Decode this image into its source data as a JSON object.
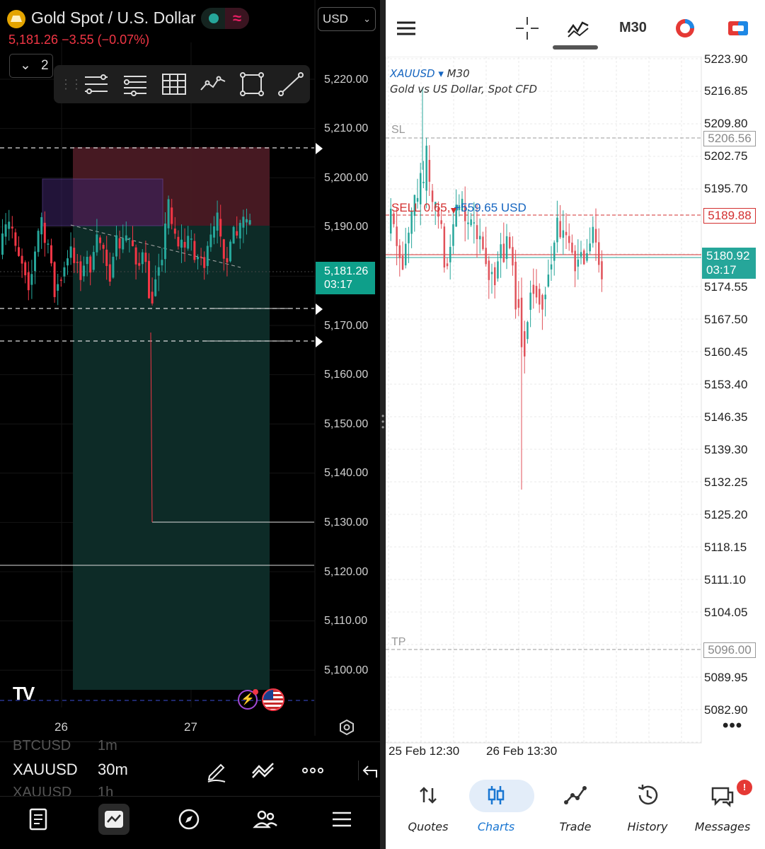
{
  "left": {
    "header": {
      "title": "Gold Spot / U.S. Dollar",
      "price_line": "5,181.26  −3.55 (−0.07%)",
      "currency": "USD",
      "layers_count": "2"
    },
    "toolbar": {
      "icons": [
        "fib-retracement-icon",
        "fib-extension-icon",
        "grid-icon",
        "trend-path-icon",
        "rectangle-icon",
        "line-icon"
      ]
    },
    "price_axis": [
      "5,220.00",
      "5,210.00",
      "5,200.00",
      "5,190.00",
      "5,170.00",
      "5,160.00",
      "5,150.00",
      "5,140.00",
      "5,130.00",
      "5,120.00",
      "5,110.00",
      "5,100.00"
    ],
    "current_price": "5,181.26",
    "countdown": "03:17",
    "dates": [
      "26",
      "27"
    ],
    "bottom": {
      "ghost_symbol_top": "BTCUSD",
      "ghost_interval_top": "1m",
      "symbol": "XAUUSD",
      "interval": "30m",
      "ghost_symbol_bottom": "XAUUSD",
      "ghost_interval_bottom": "1h"
    },
    "nav": [
      "watchlist-icon",
      "chart-icon",
      "explore-icon",
      "community-icon",
      "menu-icon"
    ]
  },
  "right": {
    "toolbar": {
      "timeframe": "M30"
    },
    "symbol": "XAUUSD",
    "symbol_timeframe": "M30",
    "description": "Gold vs US Dollar, Spot CFD",
    "price_axis": [
      "5223.90",
      "5216.85",
      "5209.80",
      "5202.75",
      "5195.70",
      "5174.55",
      "5167.50",
      "5160.45",
      "5153.40",
      "5146.35",
      "5139.30",
      "5132.25",
      "5125.20",
      "5118.15",
      "5111.10",
      "5104.05",
      "5089.95",
      "5082.90"
    ],
    "sl_label": "SL",
    "sl_price": "5206.56",
    "tp_label": "TP",
    "tp_price": "5096.00",
    "sell_text": "SELL 0.65,",
    "sell_profit": "+559.65 USD",
    "sell_price": "5189.88",
    "current_price": "5180.92",
    "countdown": "03:17",
    "dates": [
      "25 Feb 12:30",
      "26 Feb 13:30"
    ],
    "nav": [
      {
        "label": "Quotes",
        "icon": "quotes-icon"
      },
      {
        "label": "Charts",
        "icon": "charts-icon",
        "active": true
      },
      {
        "label": "Trade",
        "icon": "trade-icon"
      },
      {
        "label": "History",
        "icon": "history-icon"
      },
      {
        "label": "Messages",
        "icon": "messages-icon",
        "badge": "!"
      }
    ]
  },
  "colors": {
    "up": "#26a69a",
    "down": "#f23645",
    "mt_up": "#26a69a",
    "mt_down": "#e0525a",
    "accent_blue": "#1976d2"
  }
}
